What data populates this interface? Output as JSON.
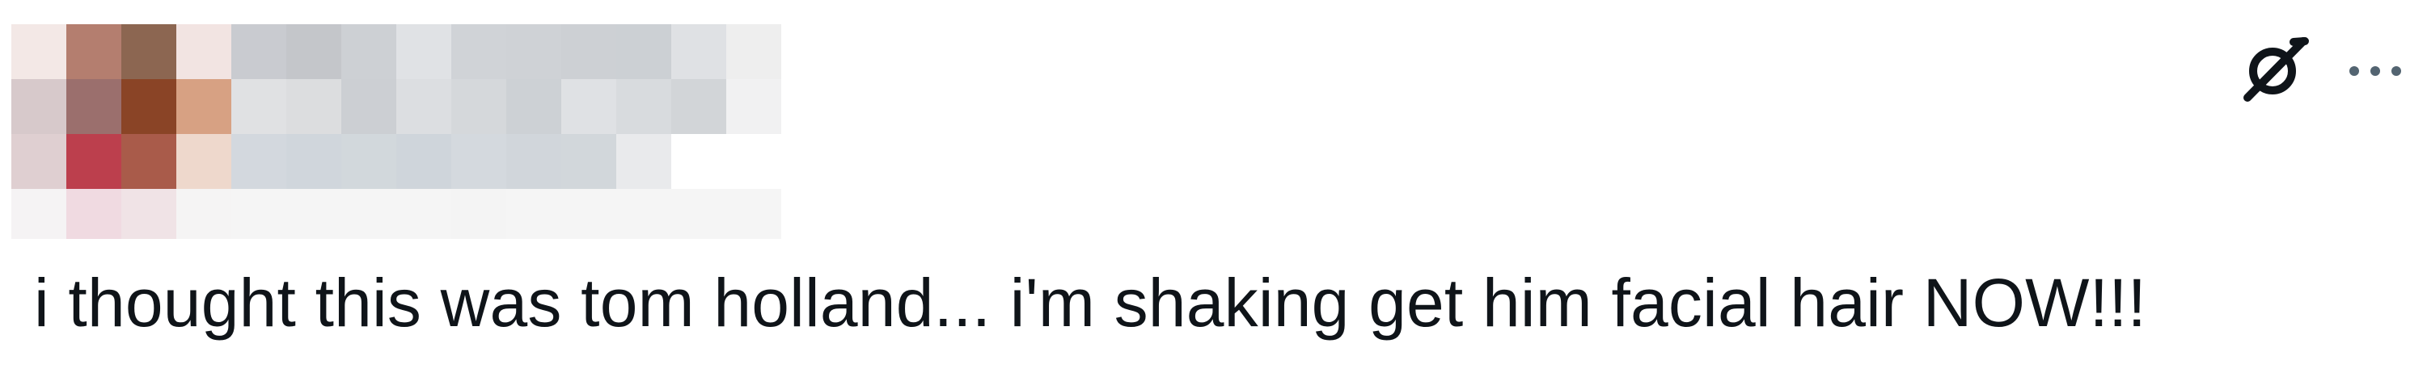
{
  "header": {
    "redacted_user_block": {
      "rows": [
        [
          "#f3e8e6",
          "#b47e6f",
          "#8c6651",
          "#f2e4e2",
          "#c9cbd0",
          "#c4c6ca",
          "#cdd0d4",
          "#e0e2e5",
          "#d0d3d7",
          "#cfd2d6",
          "#cdd0d4",
          "#ccd0d4",
          "#dfe1e4",
          "#eeeeee"
        ],
        [
          "#d7c9cb",
          "#9b6f6d",
          "#8a4426",
          "#d7a183",
          "#e0e1e3",
          "#dcdddf",
          "#cccfd3",
          "#dcdee1",
          "#d5d8db",
          "#cdd1d5",
          "#dfe1e4",
          "#d8dbde",
          "#d2d5d8",
          "#f1f1f2"
        ],
        [
          "#dfcfd1",
          "#bc3f4d",
          "#a95b4a",
          "#eed8cc",
          "#d3d8de",
          "#d0d6dc",
          "#d2d8dc",
          "#cfd5db",
          "#d4d9de",
          "#d1d6db",
          "#d2d7db",
          "#e9eaec",
          "#ffffff",
          "#ffffff"
        ],
        [
          "#f5f3f4",
          "#f0dae1",
          "#f0e3e6",
          "#f5f4f4",
          "#f5f5f5",
          "#f5f5f5",
          "#f5f5f5",
          "#f5f5f5",
          "#f4f4f4",
          "#f5f5f5",
          "#f5f5f5",
          "#f5f5f5",
          "#f5f5f5",
          "#f5f5f5"
        ]
      ]
    },
    "actions": {
      "grok_icon": "grok-icon",
      "more_icon": "more-horizontal-icon"
    }
  },
  "tweet": {
    "text": "i thought this was tom holland... i'm shaking get him facial hair NOW!!!"
  },
  "colors": {
    "text_primary": "#0f1419",
    "icon_dark": "#0f1419",
    "icon_muted": "#536471",
    "background": "#ffffff"
  }
}
